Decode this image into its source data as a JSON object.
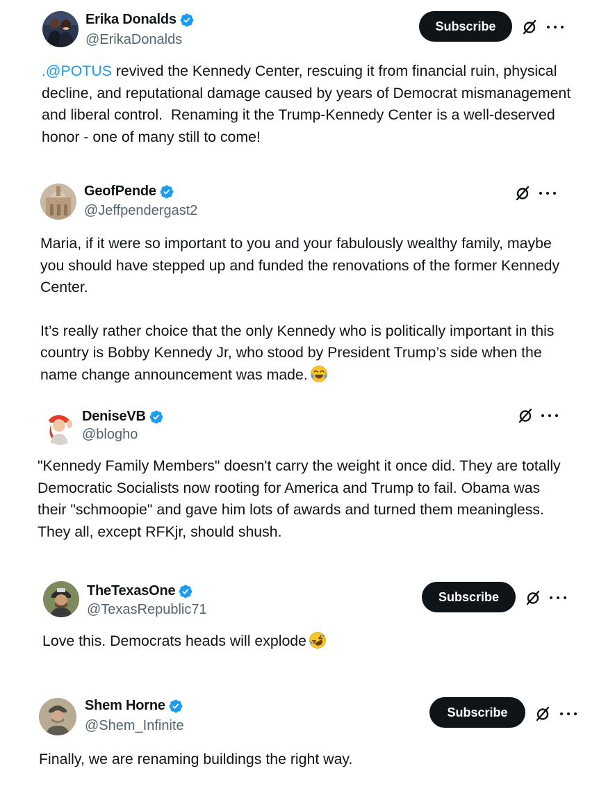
{
  "colors": {
    "text": "#0f1419",
    "secondary": "#536471",
    "accent": "#1d9bf0",
    "button_bg": "#0f1419",
    "button_text": "#ffffff"
  },
  "posts": [
    {
      "name": "Erika Donalds",
      "handle": "@ErikaDonalds",
      "verified": true,
      "subscribe_label": "Subscribe",
      "mention": ".@POTUS",
      "text": " revived the Kennedy Center, rescuing it from financial ruin, physical decline, and reputational damage caused by years of Democrat mismanagement and liberal control.  Renaming it the Trump-Kennedy Center is a well-deserved honor - one of many still to come!"
    },
    {
      "name": "GeofPende",
      "handle": "@Jeffpendergast2",
      "verified": true,
      "paragraph1": "Maria, if it were so important to you and your fabulously wealthy family, maybe you should have stepped up and funded the renovations of the former Kennedy Center.",
      "paragraph2": "It’s really rather choice that the only Kennedy who is politically important in this country is Bobby Kennedy Jr, who stood by President Trump’s side when the name change announcement was made.",
      "emoji": "face-with-tears-of-joy"
    },
    {
      "name": "DeniseVB",
      "handle": "@blogho",
      "verified": true,
      "text": "\"Kennedy Family Members\" doesn't carry the weight it once did. They are totally Democratic Socialists now rooting for America and Trump to fail. Obama was their \"schmoopie\" and gave him lots of awards and turned them meaningless.  They all, except RFKjr, should shush."
    },
    {
      "name": "TheTexasOne",
      "handle": "@TexasRepublic71",
      "verified": true,
      "subscribe_label": "Subscribe",
      "text": "Love this. Democrats heads will explode",
      "emoji": "rolling-on-the-floor-laughing"
    },
    {
      "name": "Shem Horne",
      "handle": "@Shem_Infinite",
      "verified": true,
      "subscribe_label": "Subscribe",
      "text": "Finally, we are renaming buildings the right way."
    }
  ]
}
